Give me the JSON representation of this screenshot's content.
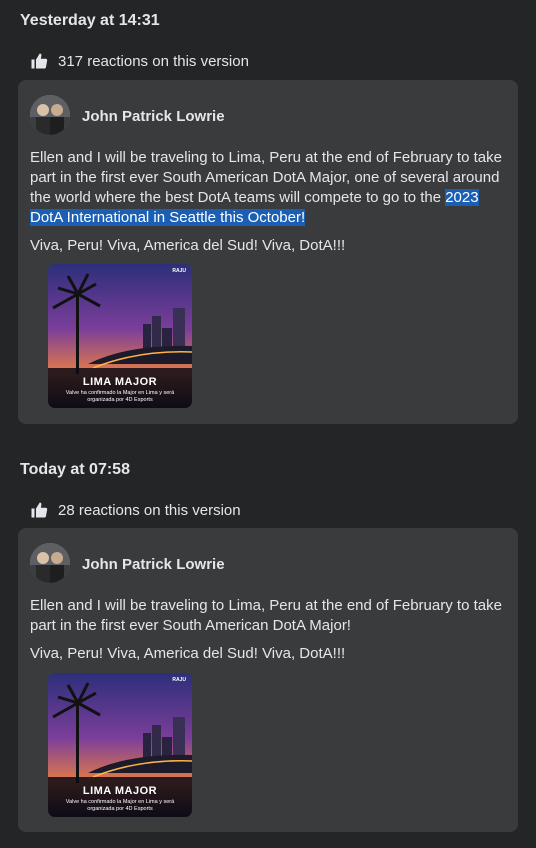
{
  "versions": [
    {
      "timestamp": "Yesterday at 14:31",
      "reactions": "317 reactions on this version",
      "author": "John Patrick Lowrie",
      "body_before": "Ellen and I will be traveling to Lima, Peru at the end of February to take part in the first ever South American DotA Major, one of several around the world where the best DotA teams will compete to go to the ",
      "body_highlight": "2023 DotA International in Seattle this October!",
      "line2": "Viva, Peru!  Viva, America del Sud!  Viva, DotA!!!",
      "image": {
        "title": "LIMA MAJOR",
        "subtitle": "Valve ha confirmado la Major en Lima y será organizada por 4D Esports",
        "tag": "RAJU"
      }
    },
    {
      "timestamp": "Today at 07:58",
      "reactions": "28 reactions on this version",
      "author": "John Patrick Lowrie",
      "body": "Ellen and I will be traveling to Lima, Peru at the end of February to take part in the first ever South American DotA Major!",
      "line2": "Viva, Peru!  Viva, America del Sud!  Viva, DotA!!!",
      "image": {
        "title": "LIMA MAJOR",
        "subtitle": "Valve ha confirmado la Major en Lima y será organizada por 4D Esports",
        "tag": "RAJU"
      }
    }
  ],
  "icons": {
    "reaction": "thumbs-up-icon"
  },
  "colors": {
    "background": "#242526",
    "card": "#3a3b3c",
    "highlight": "#1a5fb4"
  }
}
